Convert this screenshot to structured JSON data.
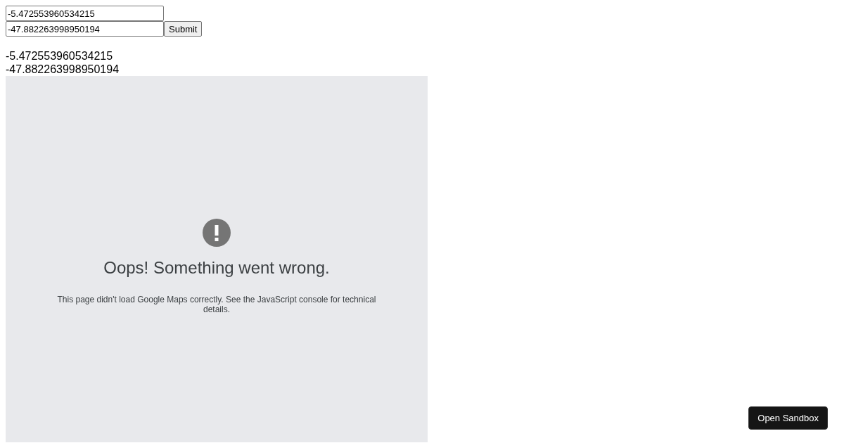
{
  "form": {
    "fields": [
      {
        "value": "-5.472553960534215"
      },
      {
        "value": "-47.882263998950194"
      }
    ],
    "submit": "Submit"
  },
  "readout": [
    "-5.472553960534215",
    "-47.882263998950194"
  ],
  "map_error": {
    "title": "Oops! Something went wrong.",
    "message": "This page didn't load Google Maps correctly. See the JavaScript console for technical details."
  },
  "sandbox_button": "Open Sandbox"
}
